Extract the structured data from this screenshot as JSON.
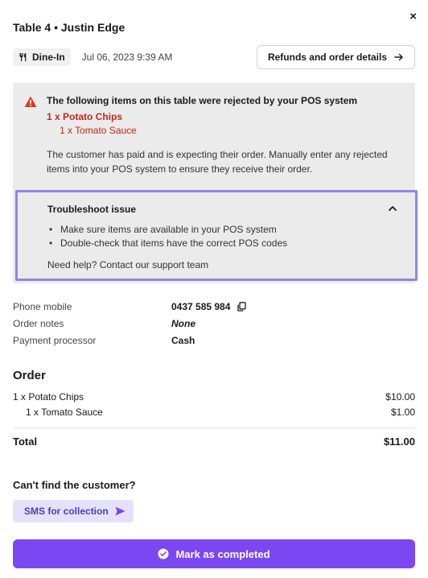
{
  "header": {
    "close_symbol": "×",
    "title": "Table 4 • Justin Edge",
    "order_type": "Dine-In",
    "datetime": "Jul 06, 2023 9:39 AM",
    "refunds_label": "Refunds and order details"
  },
  "alert": {
    "title": "The following items on this table were rejected by your POS system",
    "rejected_item": "1 x Potato Chips",
    "rejected_modifier": "1 x Tomato Sauce",
    "body": "The customer has paid and is expecting their order. Manually enter any rejected items into your POS system to ensure they receive their order."
  },
  "troubleshoot": {
    "title": "Troubleshoot issue",
    "tips": [
      "Make sure items are available in your POS system",
      "Double-check that items have the correct POS codes"
    ],
    "help": "Need help? Contact our support team"
  },
  "details": {
    "phone_label": "Phone mobile",
    "phone_value": "0437 585 984",
    "notes_label": "Order notes",
    "notes_value": "None",
    "processor_label": "Payment processor",
    "processor_value": "Cash"
  },
  "order": {
    "heading": "Order",
    "items": [
      {
        "name": "1 x Potato Chips",
        "price": "$10.00"
      },
      {
        "name": "1 x Tomato Sauce",
        "price": "$1.00"
      }
    ],
    "total_label": "Total",
    "total_value": "$11.00"
  },
  "customer": {
    "cant_find": "Can't find the customer?",
    "sms_label": "SMS for collection"
  },
  "footer": {
    "complete_label": "Mark as completed"
  },
  "colors": {
    "accent": "#7b47f0",
    "rejected_text": "#c4291c",
    "warning_icon": "#d93a1f",
    "highlight_border": "#8f87e3",
    "sms_bg": "#e4e2fa"
  },
  "icons": [
    "close-icon",
    "fork-knife-icon",
    "arrow-right-icon",
    "warning-icon",
    "chevron-up-icon",
    "copy-icon",
    "send-icon",
    "check-circle-icon"
  ]
}
